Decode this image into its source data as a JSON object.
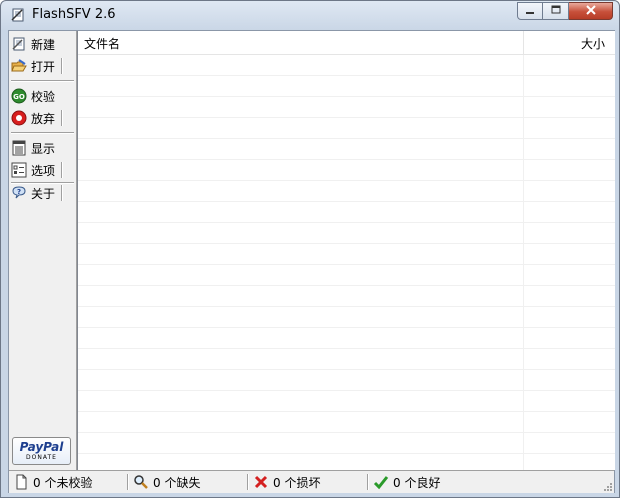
{
  "window": {
    "title": "FlashSFV 2.6",
    "icon": "flashsfv-app-icon",
    "controls": {
      "minimize": "minimize-icon",
      "maximize": "maximize-icon",
      "close": "close-icon"
    }
  },
  "toolbar": {
    "new_label": "新建",
    "open_label": "打开",
    "verify_label": "校验",
    "abort_label": "放弃",
    "show_label": "显示",
    "options_label": "选项",
    "about_label": "关于",
    "icons": {
      "new": "new-file-icon",
      "open": "open-folder-icon",
      "verify": "go-icon",
      "abort": "stop-icon",
      "show": "display-icon",
      "options": "options-icon",
      "about": "help-icon"
    }
  },
  "donate": {
    "logo": "PayPal",
    "label": "DONATE"
  },
  "list": {
    "columns": [
      "文件名",
      "大小"
    ],
    "rows": []
  },
  "status": {
    "unverified": "0 个未校验",
    "missing": "0 个缺失",
    "damaged": "0 个损坏",
    "good": "0 个良好",
    "icons": {
      "unverified": "page-icon",
      "missing": "magnifier-icon",
      "damaged": "red-x-icon",
      "good": "green-check-icon"
    }
  },
  "colors": {
    "go": "#2e8b2e",
    "stop": "#d81e1e",
    "check": "#2a9a2a",
    "bad": "#d42020",
    "paypal": "#1e3f8f"
  }
}
